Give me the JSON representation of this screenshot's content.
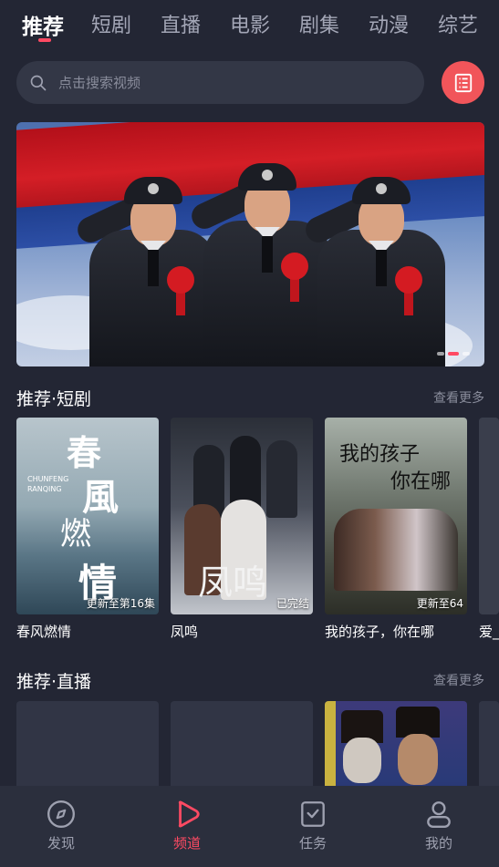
{
  "top_tabs": [
    {
      "label": "推荐",
      "active": true
    },
    {
      "label": "短剧",
      "active": false
    },
    {
      "label": "直播",
      "active": false
    },
    {
      "label": "电影",
      "active": false
    },
    {
      "label": "剧集",
      "active": false
    },
    {
      "label": "动漫",
      "active": false
    },
    {
      "label": "综艺",
      "active": false
    }
  ],
  "search": {
    "placeholder": "点击搜索视频",
    "icon": "search-icon"
  },
  "menu_button": {
    "icon": "list-icon",
    "color": "#f1555a"
  },
  "accent_color": "#ff4a63",
  "banner": {
    "dot_count": 3,
    "active_dot": 2
  },
  "section_shorts": {
    "title": "推荐·短剧",
    "more": "查看更多",
    "items": [
      {
        "title": "春风燃情",
        "status": "更新至第16集",
        "poster_text": [
          "春",
          "風",
          "燃",
          "情"
        ],
        "poster_subtext": "CHUNFENG RANQING"
      },
      {
        "title": "凤鸣",
        "status": "已完结",
        "poster_text": [
          "凤鸣"
        ]
      },
      {
        "title": "我的孩子，你在哪",
        "status": "更新至64",
        "poster_text": [
          "我的孩子",
          "你在哪"
        ]
      },
      {
        "title": "爱_"
      }
    ]
  },
  "section_live": {
    "title": "推荐·直播",
    "more": "查看更多"
  },
  "bottom_nav": [
    {
      "label": "发现",
      "icon": "compass-icon",
      "active": false
    },
    {
      "label": "频道",
      "icon": "play-icon",
      "active": true
    },
    {
      "label": "任务",
      "icon": "task-icon",
      "active": false
    },
    {
      "label": "我的",
      "icon": "profile-icon",
      "active": false
    }
  ]
}
